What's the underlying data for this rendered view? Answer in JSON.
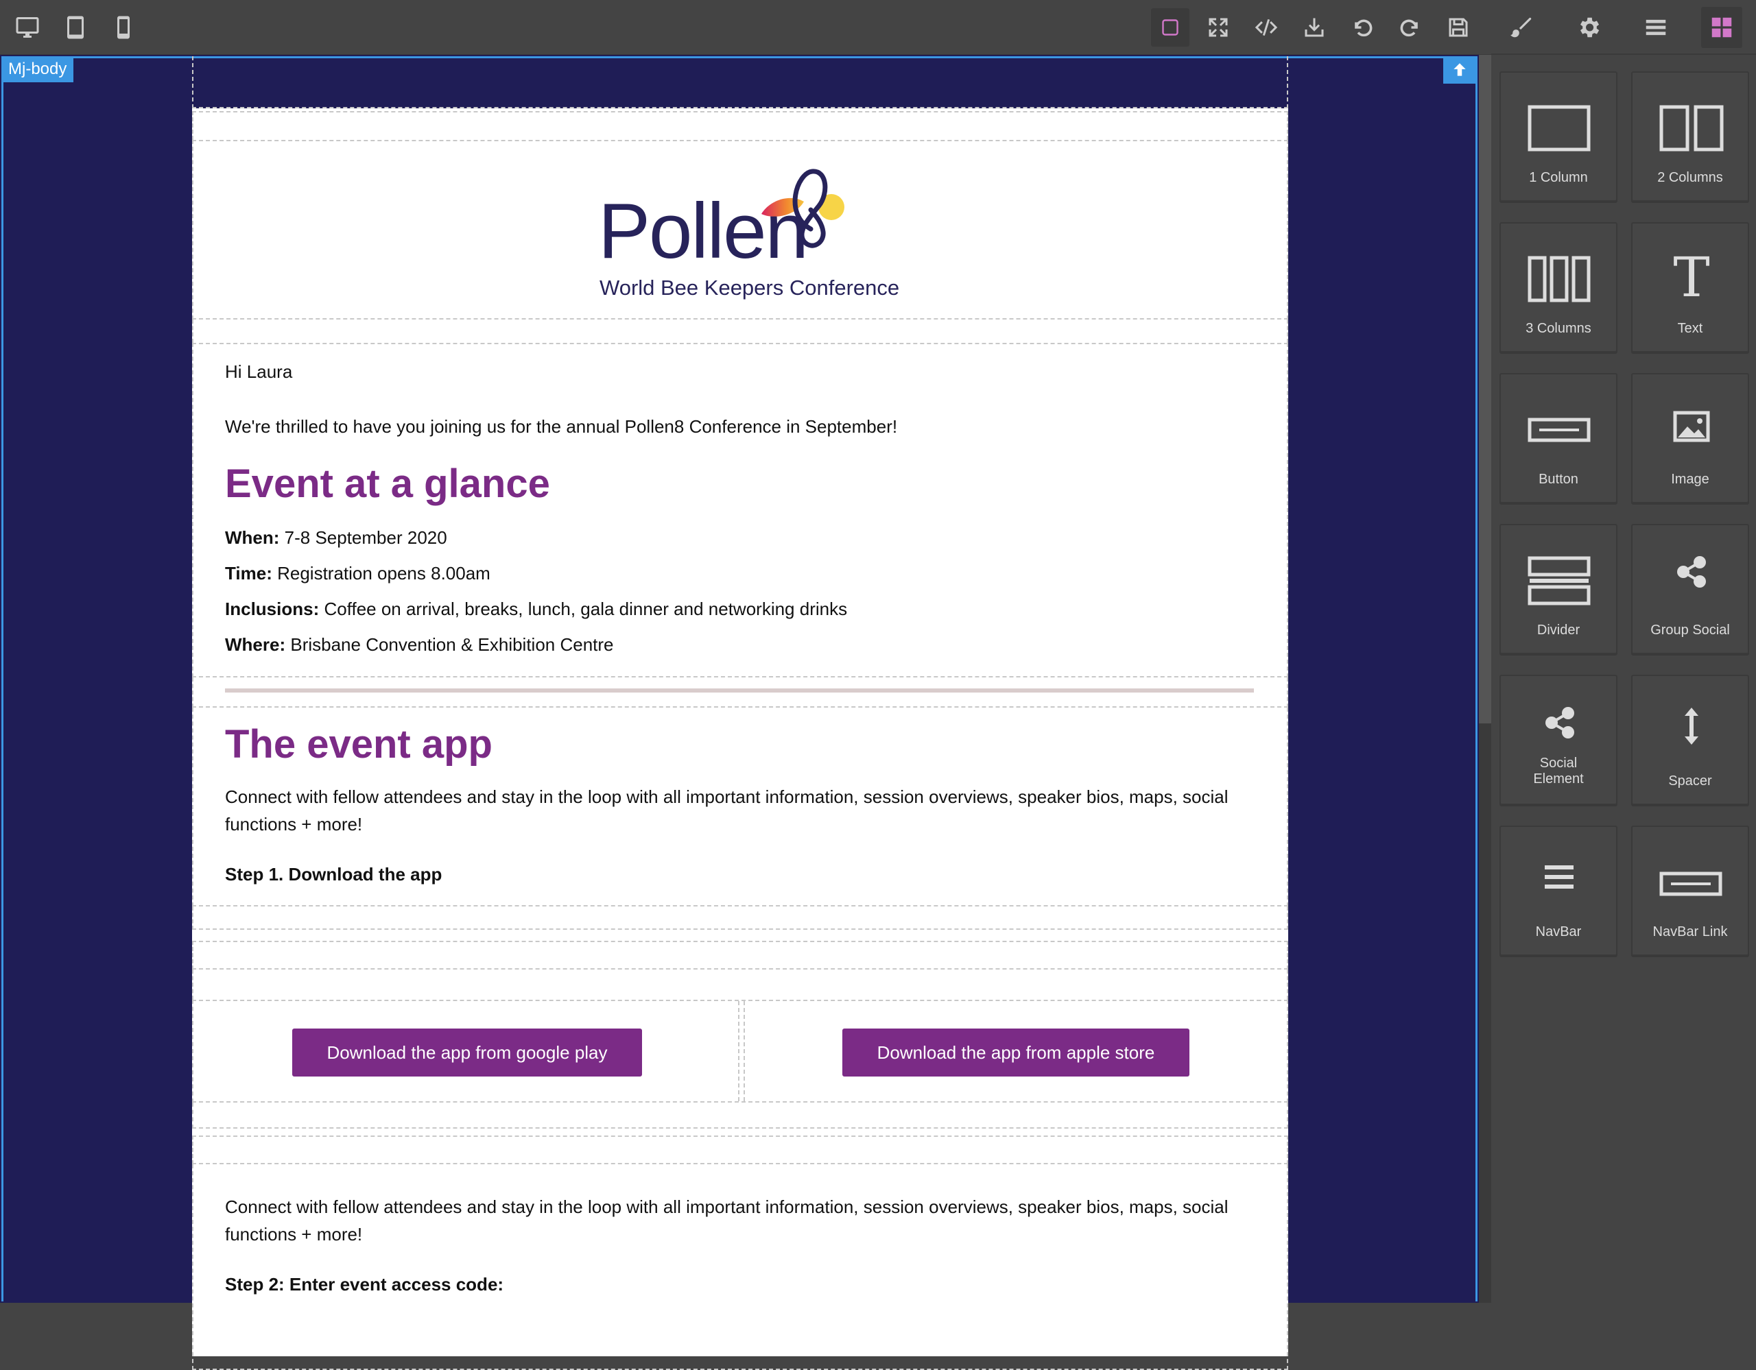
{
  "toolbar": {
    "devices": [
      "desktop-icon",
      "tablet-icon",
      "mobile-icon"
    ],
    "actions": [
      "sw-visibility-icon",
      "fullscreen-icon",
      "code-icon",
      "export-icon",
      "undo-icon",
      "redo-icon",
      "save-icon"
    ]
  },
  "panel": {
    "tabs": [
      "style-manager-icon",
      "settings-icon",
      "layer-manager-icon",
      "blocks-icon"
    ],
    "blocks": [
      {
        "label": "1 Column",
        "icon": "one-column-icon"
      },
      {
        "label": "2 Columns",
        "icon": "two-columns-icon"
      },
      {
        "label": "3 Columns",
        "icon": "three-columns-icon"
      },
      {
        "label": "Text",
        "icon": "text-icon"
      },
      {
        "label": "Button",
        "icon": "button-icon"
      },
      {
        "label": "Image",
        "icon": "image-icon"
      },
      {
        "label": "Divider",
        "icon": "divider-icon"
      },
      {
        "label": "Group Social",
        "icon": "share-icon"
      },
      {
        "label": "Social Element",
        "label2": "Social\nElement",
        "icon": "share-icon"
      },
      {
        "label": "Spacer",
        "icon": "spacer-icon"
      },
      {
        "label": "NavBar",
        "icon": "navbar-icon"
      },
      {
        "label": "NavBar Link",
        "icon": "navbar-link-icon"
      }
    ]
  },
  "canvas": {
    "selected_badge": "Mj-body"
  },
  "email": {
    "logo": {
      "wordmark": "Pollen",
      "tagline": "World Bee Keepers Conference"
    },
    "greeting": "Hi Laura",
    "intro": "We're thrilled to have you joining us for the annual Pollen8 Conference in September!",
    "glance_heading": "Event at a glance",
    "details": [
      {
        "label": "When:",
        "value": " 7-8 September 2020"
      },
      {
        "label": "Time:",
        "value": " Registration opens 8.00am"
      },
      {
        "label": "Inclusions:",
        "value": " Coffee on arrival, breaks, lunch, gala dinner and networking drinks"
      },
      {
        "label": "Where:",
        "value": " Brisbane Convention & Exhibition Centre"
      }
    ],
    "app_heading": "The event app",
    "app_text": "Connect with fellow attendees and stay in the loop with all important information, session overviews, speaker bios, maps, social functions + more!",
    "step1": "Step 1. Download the app",
    "google_button": "Download the app from google play",
    "apple_button": "Download the app from apple store",
    "app_text2": "Connect with fellow attendees and stay in the loop with all important information, session overviews, speaker bios, maps, social functions + more!",
    "step2": "Step 2: Enter event access code:"
  },
  "colors": {
    "canvas_bg": "#1f1d56",
    "heading": "#7b2b86",
    "button_bg": "#7b2b86",
    "selection": "#3b97e3",
    "panel_bg": "#444444",
    "active_pink": "#d278c9"
  }
}
